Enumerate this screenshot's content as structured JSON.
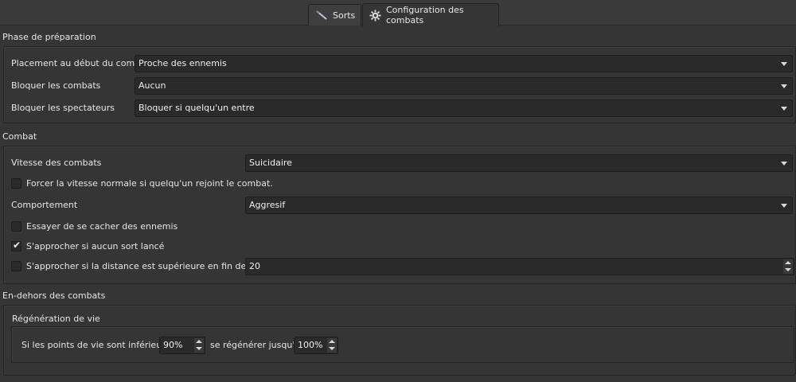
{
  "tabs": [
    {
      "label": "Sorts",
      "icon": "wand-icon",
      "active": false
    },
    {
      "label": "Configuration des combats",
      "icon": "gear-icon",
      "active": true
    }
  ],
  "preparation": {
    "title": "Phase de préparation",
    "placement_label": "Placement au début du combat",
    "placement_value": "Proche des ennemis",
    "block_fights_label": "Bloquer les combats",
    "block_fights_value": "Aucun",
    "block_spectators_label": "Bloquer les spectateurs",
    "block_spectators_value": "Bloquer si quelqu'un entre"
  },
  "combat": {
    "title": "Combat",
    "speed_label": "Vitesse des combats",
    "speed_value": "Suicidaire",
    "force_normal_label": "Forcer la vitesse normale si quelqu'un rejoint le combat.",
    "force_normal_checked": false,
    "behavior_label": "Comportement",
    "behavior_value": "Aggresif",
    "hide_label": "Essayer de se cacher des ennemis",
    "hide_checked": false,
    "approach_label": "S'approcher si aucun sort lancé",
    "approach_checked": true,
    "approach_distance_label": "S'approcher si la distance est supérieure en fin de tour",
    "approach_distance_checked": false,
    "approach_distance_value": "20"
  },
  "outside": {
    "title": "En-dehors des combats",
    "regen_title": "Régénération de vie",
    "if_hp_label": "Si les points de vie sont inférieurs à",
    "if_hp_value": "90%",
    "regen_until_label": "se régénérer jusqu'à",
    "regen_until_value": "100%"
  }
}
